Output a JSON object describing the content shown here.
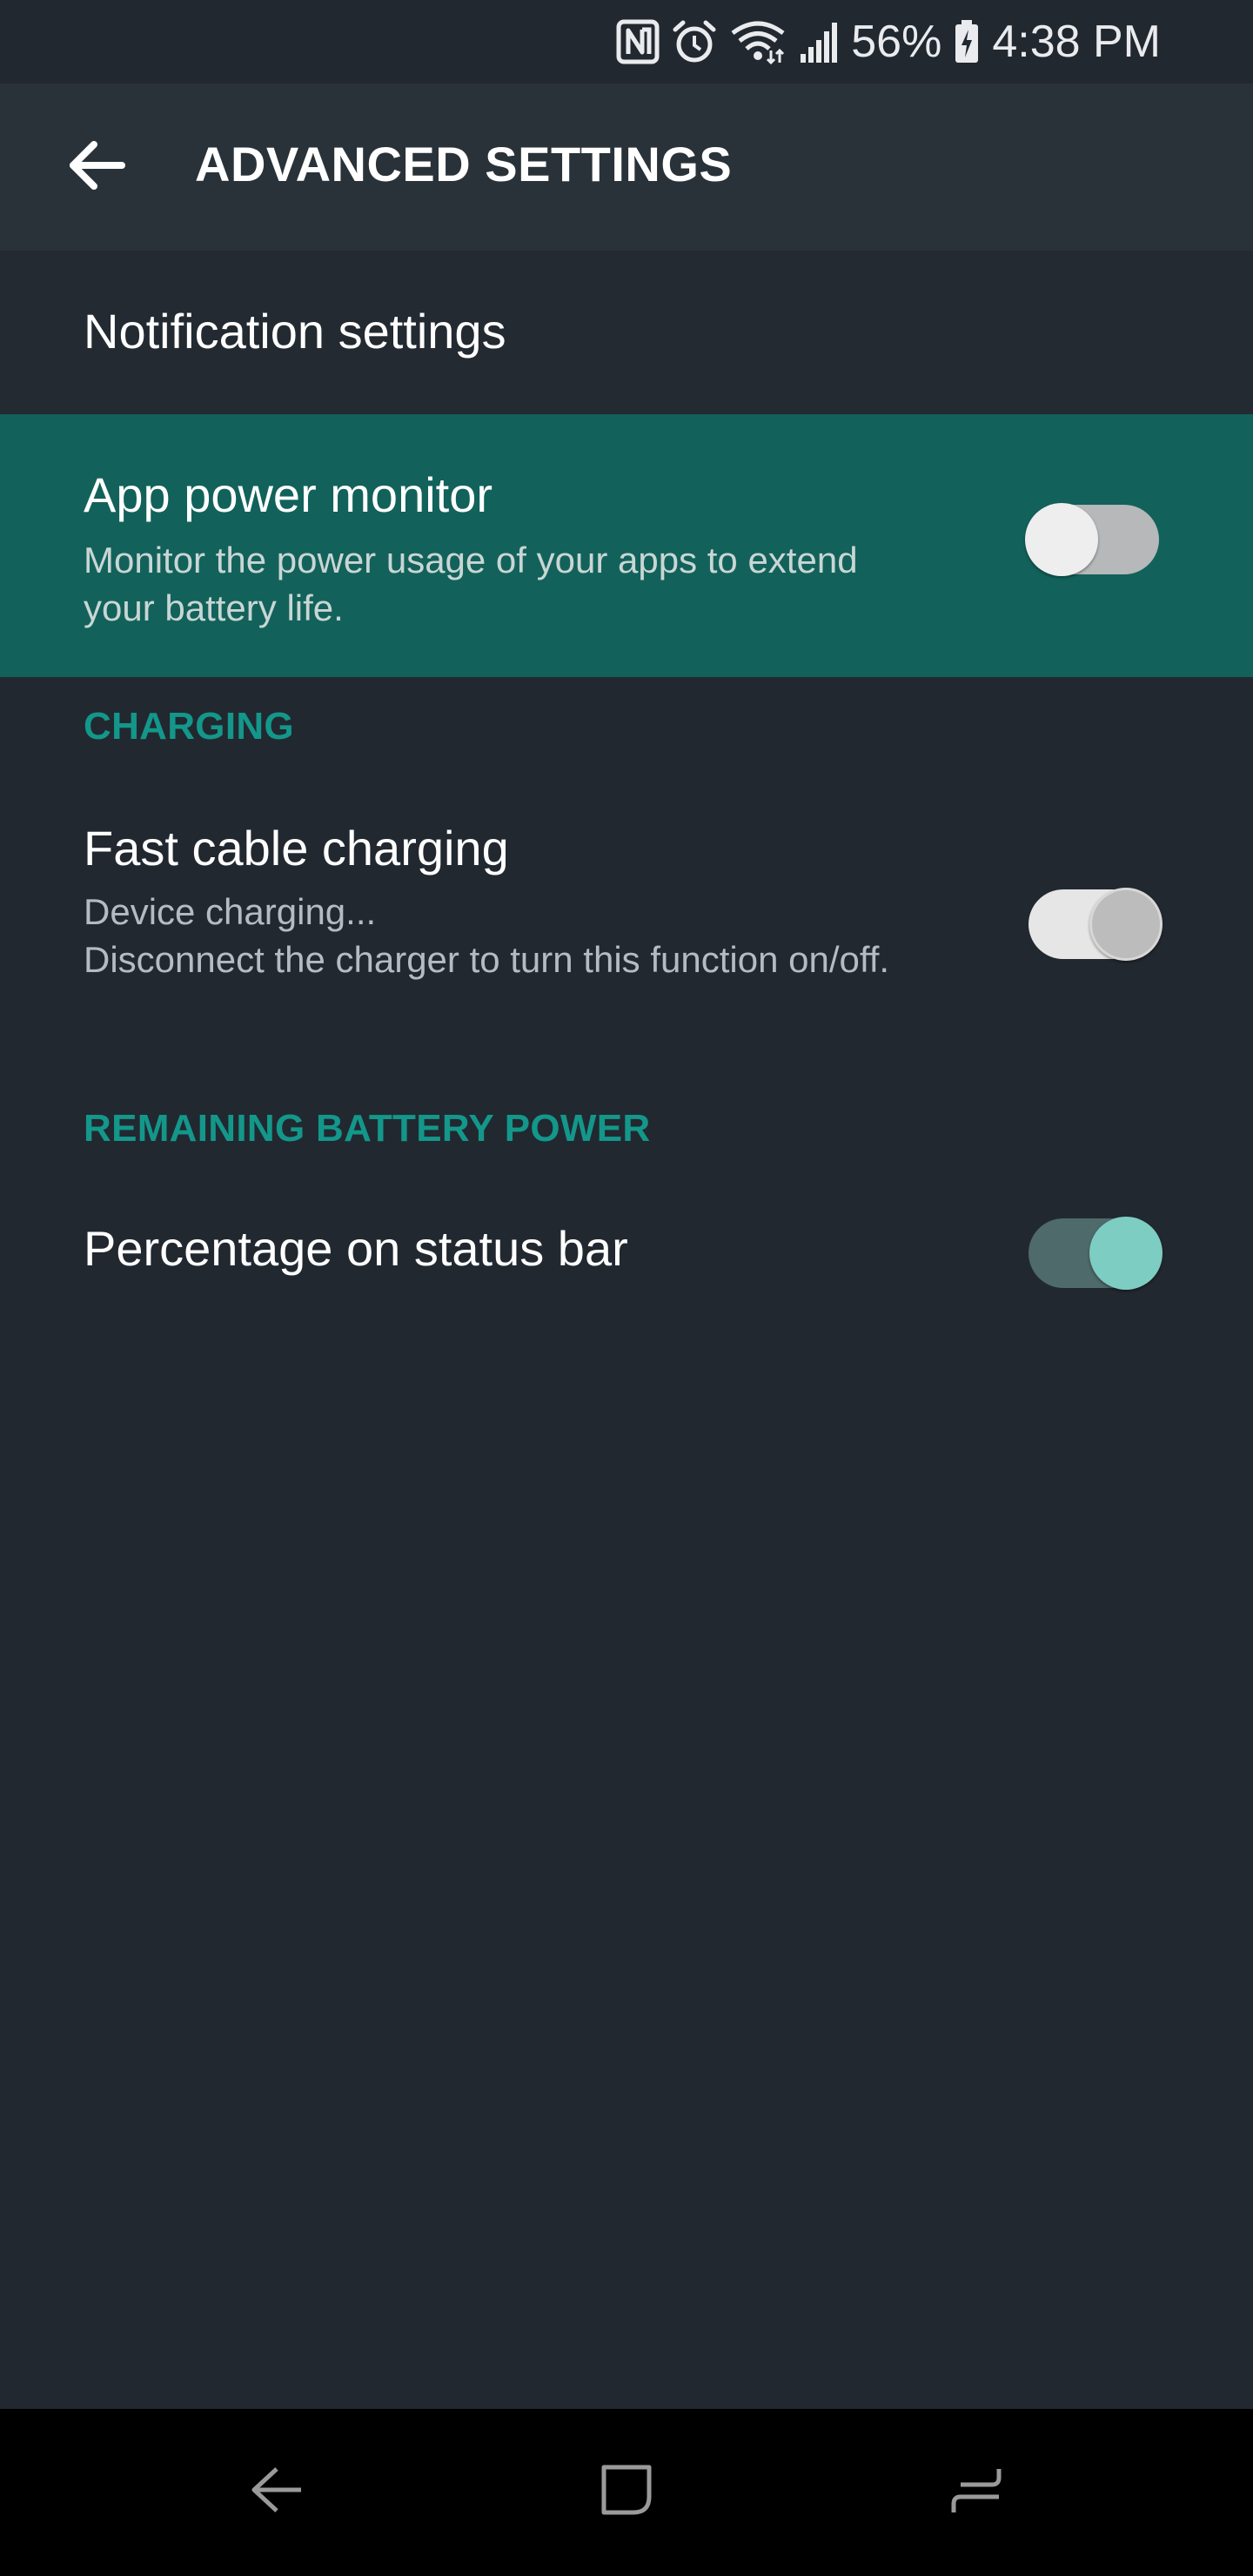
{
  "status_bar": {
    "battery_percent": "56%",
    "time": "4:38 PM",
    "icons": [
      "nfc-icon",
      "alarm-icon",
      "wifi-icon",
      "signal-icon",
      "battery-charging-icon"
    ]
  },
  "header": {
    "title": "ADVANCED SETTINGS",
    "back_icon": "arrow-left-icon"
  },
  "settings": {
    "notification": {
      "title": "Notification settings"
    },
    "app_power_monitor": {
      "title": "App power monitor",
      "subtitle": "Monitor the power usage of your apps to extend your battery life.",
      "enabled": false
    },
    "charging_section": {
      "header": "CHARGING"
    },
    "fast_cable_charging": {
      "title": "Fast cable charging",
      "subtitle_line1": "Device charging...",
      "subtitle_line2": "Disconnect the charger to turn this function on/off.",
      "enabled": true,
      "disabled": true
    },
    "remaining_section": {
      "header": "REMAINING BATTERY POWER"
    },
    "percentage_on_status_bar": {
      "title": "Percentage on status bar",
      "enabled": true
    }
  },
  "colors": {
    "background": "#222830",
    "header_background": "#2a3239",
    "highlight_row": "#12625b",
    "section_header": "#13978a",
    "toggle_on_knob": "#7ecdc3",
    "toggle_on_track": "#4e6a6a"
  },
  "nav_bar": {
    "icons": [
      "nav-back-icon",
      "nav-home-icon",
      "nav-recents-icon"
    ]
  }
}
